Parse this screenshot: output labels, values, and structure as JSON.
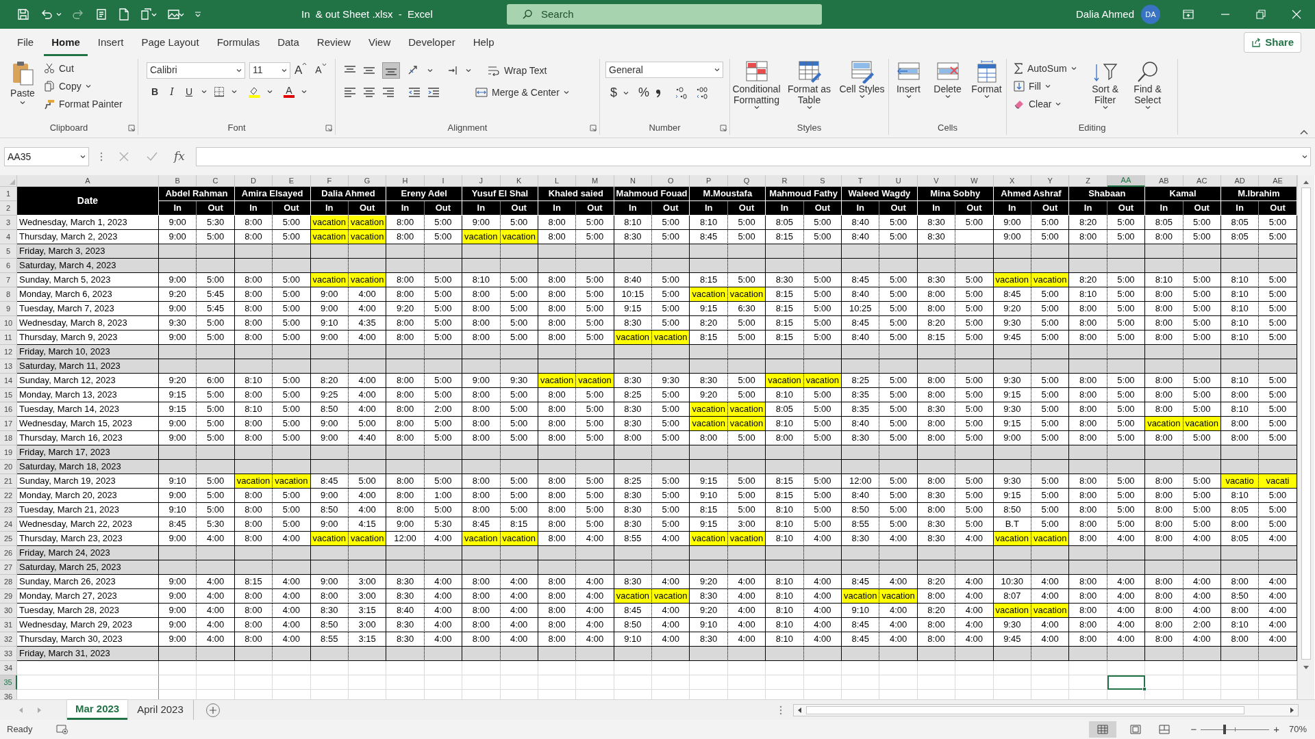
{
  "title_bar": {
    "file_title": "In  & out Sheet .xlsx  -  Excel",
    "search_placeholder": "Search",
    "user_name": "Dalia Ahmed",
    "user_initials": "DA"
  },
  "menu_tabs": [
    {
      "label": "File",
      "selected": false
    },
    {
      "label": "Home",
      "selected": true
    },
    {
      "label": "Insert",
      "selected": false
    },
    {
      "label": "Page Layout",
      "selected": false
    },
    {
      "label": "Formulas",
      "selected": false
    },
    {
      "label": "Data",
      "selected": false
    },
    {
      "label": "Review",
      "selected": false
    },
    {
      "label": "View",
      "selected": false
    },
    {
      "label": "Developer",
      "selected": false
    },
    {
      "label": "Help",
      "selected": false
    }
  ],
  "share": "Share",
  "ribbon": {
    "clipboard": {
      "paste": "Paste",
      "cut": "Cut",
      "copy": "Copy",
      "format_painter": "Format Painter",
      "label": "Clipboard"
    },
    "font": {
      "family": "Calibri",
      "size": "11",
      "grow": "A",
      "shrink": "A",
      "bold": "B",
      "italic": "I",
      "underline": "U",
      "font_color": "A",
      "label": "Font"
    },
    "alignment": {
      "wrap_text": "Wrap Text",
      "merge_center": "Merge & Center",
      "label": "Alignment"
    },
    "number": {
      "format": "General",
      "currency": "$",
      "percent": "%",
      "label": "Number"
    },
    "styles": {
      "buttons": [
        "Conditional Formatting",
        "Format as Table",
        "Cell Styles"
      ],
      "label": "Styles"
    },
    "cells": {
      "buttons": [
        "Insert",
        "Delete",
        "Format"
      ],
      "label": "Cells"
    },
    "editing": {
      "autosum": "AutoSum",
      "fill": "Fill",
      "clear": "Clear",
      "sort_filter": "Sort & Filter",
      "find_select": "Find & Select",
      "label": "Editing"
    }
  },
  "formula_bar": {
    "name_box": "AA35",
    "fx": "fx"
  },
  "sheet": {
    "columns": [
      {
        "letter": "A",
        "selected": false
      },
      {
        "letter": "B",
        "selected": false
      },
      {
        "letter": "C",
        "selected": false
      },
      {
        "letter": "D",
        "selected": false
      },
      {
        "letter": "E",
        "selected": false
      },
      {
        "letter": "F",
        "selected": false
      },
      {
        "letter": "G",
        "selected": false
      },
      {
        "letter": "H",
        "selected": false
      },
      {
        "letter": "I",
        "selected": false
      },
      {
        "letter": "J",
        "selected": false
      },
      {
        "letter": "K",
        "selected": false
      },
      {
        "letter": "L",
        "selected": false
      },
      {
        "letter": "M",
        "selected": false
      },
      {
        "letter": "N",
        "selected": false
      },
      {
        "letter": "O",
        "selected": false
      },
      {
        "letter": "P",
        "selected": false
      },
      {
        "letter": "Q",
        "selected": false
      },
      {
        "letter": "R",
        "selected": false
      },
      {
        "letter": "S",
        "selected": false
      },
      {
        "letter": "T",
        "selected": false
      },
      {
        "letter": "U",
        "selected": false
      },
      {
        "letter": "V",
        "selected": false
      },
      {
        "letter": "W",
        "selected": false
      },
      {
        "letter": "X",
        "selected": false
      },
      {
        "letter": "Y",
        "selected": false
      },
      {
        "letter": "Z",
        "selected": false
      },
      {
        "letter": "AA",
        "selected": true
      },
      {
        "letter": "AB",
        "selected": false
      },
      {
        "letter": "AC",
        "selected": false
      },
      {
        "letter": "AD",
        "selected": false
      },
      {
        "letter": "AE",
        "selected": false
      }
    ],
    "header_row_numbers": [
      "1",
      "2"
    ],
    "date_header": "Date",
    "employees": [
      "Abdel Rahman",
      "Amira Elsayed",
      "Dalia Ahmed",
      "Ereny Adel",
      "Yusuf El Shal",
      "Khaled saied",
      "Mahmoud Fouad",
      "M.Moustafa",
      "Mahmoud Fathy",
      "Waleed Wagdy",
      "Mina Sobhy",
      "Ahmed Ashraf",
      "Shabaan",
      "Kamal",
      "M.Ibrahim"
    ],
    "subheaders": [
      "In",
      "Out",
      "In",
      "Out",
      "In",
      "Out",
      "In",
      "Out",
      "In",
      "Out",
      "In",
      "Out",
      "In",
      "Out",
      "In",
      "Out",
      "In",
      "Out",
      "In",
      "Out",
      "In",
      "Out",
      "In",
      "Out",
      "In",
      "Out",
      "In",
      "Out",
      "In",
      "Out"
    ],
    "rows": [
      {
        "number": "3",
        "date": "Wednesday, March 1, 2023",
        "weekend": false,
        "cells": [
          "9:00",
          "5:30",
          "8:00",
          "5:00",
          {
            "text": "vacation",
            "highlighted": true
          },
          {
            "text": "vacation",
            "highlighted": true
          },
          "8:00",
          "5:00",
          "9:00",
          "5:00",
          "8:00",
          "5:00",
          "8:10",
          "5:00",
          "8:10",
          "5:00",
          "8:05",
          "5:00",
          "8:40",
          "5:00",
          "8:30",
          "5:00",
          "9:00",
          "5:00",
          "8:20",
          "5:00",
          "8:05",
          "5:00",
          "8:05",
          "5:00"
        ]
      },
      {
        "number": "4",
        "date": "Thursday, March 2, 2023",
        "weekend": false,
        "cells": [
          "9:00",
          "5:00",
          "8:00",
          "5:00",
          {
            "text": "vacation",
            "highlighted": true
          },
          {
            "text": "vacation",
            "highlighted": true
          },
          "8:00",
          "5:00",
          {
            "text": "vacation",
            "highlighted": true
          },
          {
            "text": "vacation",
            "highlighted": true
          },
          "8:00",
          "5:00",
          "8:30",
          "5:00",
          "8:45",
          "5:00",
          "8:15",
          "5:00",
          "8:40",
          "5:00",
          "8:30",
          null,
          "9:00",
          "5:00",
          "8:00",
          "5:00",
          "8:00",
          "5:00",
          "8:05",
          "5:00"
        ]
      },
      {
        "number": "5",
        "date": "Friday, March 3, 2023",
        "weekend": true
      },
      {
        "number": "6",
        "date": "Saturday, March 4, 2023",
        "weekend": true
      },
      {
        "number": "7",
        "date": "Sunday, March 5, 2023",
        "weekend": false,
        "cells": [
          "9:00",
          "5:00",
          "8:00",
          "5:00",
          {
            "text": "vacation",
            "highlighted": true
          },
          {
            "text": "vacation",
            "highlighted": true
          },
          "8:00",
          "5:00",
          "8:10",
          "5:00",
          "8:00",
          "5:00",
          "8:40",
          "5:00",
          "8:15",
          "5:00",
          "8:30",
          "5:00",
          "8:45",
          "5:00",
          "8:30",
          "5:00",
          {
            "text": "vacation",
            "highlighted": true
          },
          {
            "text": "vacation",
            "highlighted": true
          },
          "8:20",
          "5:00",
          "8:10",
          "5:00",
          "8:10",
          "5:00"
        ]
      },
      {
        "number": "8",
        "date": "Monday, March 6, 2023",
        "weekend": false,
        "cells": [
          "9:20",
          "5:45",
          "8:00",
          "5:00",
          "9:00",
          "4:00",
          "8:00",
          "5:00",
          "8:00",
          "5:00",
          "8:00",
          "5:00",
          "10:15",
          "5:00",
          {
            "text": "vacation",
            "highlighted": true
          },
          {
            "text": "vacation",
            "highlighted": true
          },
          "8:15",
          "5:00",
          "8:40",
          "5:00",
          "8:00",
          "5:00",
          "8:45",
          "5:00",
          "8:10",
          "5:00",
          "8:00",
          "5:00",
          "8:10",
          "5:00"
        ]
      },
      {
        "number": "9",
        "date": "Tuesday, March 7, 2023",
        "weekend": false,
        "cells": [
          "9:00",
          "5:45",
          "8:00",
          "5:00",
          "9:00",
          "4:00",
          "9:20",
          "5:00",
          "8:00",
          "5:00",
          "8:00",
          "5:00",
          "9:15",
          "5:00",
          "9:15",
          "6:30",
          "8:15",
          "5:00",
          "10:25",
          "5:00",
          "8:00",
          "5:00",
          "9:20",
          "5:00",
          "8:00",
          "5:00",
          "8:00",
          "5:00",
          "8:10",
          "5:00"
        ]
      },
      {
        "number": "10",
        "date": "Wednesday, March 8, 2023",
        "weekend": false,
        "cells": [
          "9:30",
          "5:00",
          "8:00",
          "5:00",
          "9:10",
          "4:35",
          "8:00",
          "5:00",
          "8:00",
          "5:00",
          "8:00",
          "5:00",
          "8:30",
          "5:00",
          "8:20",
          "5:00",
          "8:15",
          "5:00",
          "8:45",
          "5:00",
          "8:20",
          "5:00",
          "9:30",
          "5:00",
          "8:00",
          "5:00",
          "8:00",
          "5:00",
          "8:10",
          "5:00"
        ]
      },
      {
        "number": "11",
        "date": "Thursday, March 9, 2023",
        "weekend": false,
        "cells": [
          "9:00",
          "5:00",
          "8:00",
          "5:00",
          "9:00",
          "4:00",
          "8:00",
          "5:00",
          "8:00",
          "5:00",
          "8:00",
          "5:00",
          {
            "text": "vacation",
            "highlighted": true
          },
          {
            "text": "vacation",
            "highlighted": true
          },
          "8:15",
          "5:00",
          "8:15",
          "5:00",
          "8:40",
          "5:00",
          "8:15",
          "5:00",
          "9:45",
          "5:00",
          "8:00",
          "5:00",
          "8:00",
          "5:00",
          "8:10",
          "5:00"
        ]
      },
      {
        "number": "12",
        "date": "Friday, March 10, 2023",
        "weekend": true
      },
      {
        "number": "13",
        "date": "Saturday, March 11, 2023",
        "weekend": true
      },
      {
        "number": "14",
        "date": "Sunday, March 12, 2023",
        "weekend": false,
        "cells": [
          "9:20",
          "6:00",
          "8:10",
          "5:00",
          "8:20",
          "4:00",
          "8:00",
          "5:00",
          "9:00",
          "9:30",
          {
            "text": "vacation",
            "highlighted": true
          },
          {
            "text": "vacation",
            "highlighted": true
          },
          "8:30",
          "9:30",
          "8:30",
          "5:00",
          {
            "text": "vacation",
            "highlighted": true
          },
          {
            "text": "vacation",
            "highlighted": true
          },
          "8:25",
          "5:00",
          "8:00",
          "5:00",
          "9:30",
          "5:00",
          "8:00",
          "5:00",
          "8:00",
          "5:00",
          "8:10",
          "5:00"
        ]
      },
      {
        "number": "15",
        "date": "Monday, March 13, 2023",
        "weekend": false,
        "cells": [
          "9:15",
          "5:00",
          "8:00",
          "5:00",
          "9:25",
          "4:00",
          "8:00",
          "5:00",
          "8:00",
          "5:00",
          "8:00",
          "5:00",
          "8:25",
          "5:00",
          "9:20",
          "5:00",
          "8:10",
          "5:00",
          "8:35",
          "5:00",
          "8:00",
          "5:00",
          "9:15",
          "5:00",
          "8:00",
          "5:00",
          "8:00",
          "5:00",
          "8:00",
          "5:00"
        ]
      },
      {
        "number": "16",
        "date": "Tuesday, March 14, 2023",
        "weekend": false,
        "cells": [
          "9:15",
          "5:00",
          "8:10",
          "5:00",
          "8:50",
          "4:00",
          "8:00",
          "2:00",
          "8:00",
          "5:00",
          "8:00",
          "5:00",
          "8:30",
          "5:00",
          {
            "text": "vacation",
            "highlighted": true
          },
          {
            "text": "vacation",
            "highlighted": true
          },
          "8:05",
          "5:00",
          "8:35",
          "5:00",
          "8:30",
          "5:00",
          "9:30",
          "5:00",
          "8:00",
          "5:00",
          "8:00",
          "5:00",
          "8:10",
          "5:00"
        ]
      },
      {
        "number": "17",
        "date": "Wednesday, March 15, 2023",
        "weekend": false,
        "cells": [
          "9:00",
          "5:00",
          "8:00",
          "5:00",
          "9:00",
          "5:00",
          "8:00",
          "5:00",
          "8:00",
          "5:00",
          "8:00",
          "5:00",
          "8:30",
          "5:00",
          {
            "text": "vacation",
            "highlighted": true
          },
          {
            "text": "vacation",
            "highlighted": true
          },
          "8:10",
          "5:00",
          "8:40",
          "5:00",
          "8:00",
          "5:00",
          "9:15",
          "5:00",
          "8:00",
          "5:00",
          {
            "text": "vacation",
            "highlighted": true
          },
          {
            "text": "vacation",
            "highlighted": true
          },
          "8:00",
          "5:00"
        ]
      },
      {
        "number": "18",
        "date": "Thursday, March 16, 2023",
        "weekend": false,
        "cells": [
          "9:00",
          "5:00",
          "8:00",
          "5:00",
          "9:00",
          "4:40",
          "8:00",
          "5:00",
          "8:00",
          "5:00",
          "8:00",
          "5:00",
          "8:00",
          "5:00",
          "8:00",
          "5:00",
          "8:00",
          "5:00",
          "8:30",
          "5:00",
          "8:00",
          "5:00",
          "9:00",
          "5:00",
          "8:00",
          "5:00",
          "8:00",
          "5:00",
          "8:00",
          "5:00"
        ]
      },
      {
        "number": "19",
        "date": "Friday, March 17, 2023",
        "weekend": true
      },
      {
        "number": "20",
        "date": "Saturday, March 18, 2023",
        "weekend": true
      },
      {
        "number": "21",
        "date": "Sunday, March 19, 2023",
        "weekend": false,
        "cells": [
          "9:10",
          "5:00",
          {
            "text": "vacation",
            "highlighted": true
          },
          {
            "text": "vacation",
            "highlighted": true
          },
          "8:45",
          "5:00",
          "8:00",
          "5:00",
          "8:00",
          "5:00",
          "8:00",
          "5:00",
          "8:25",
          "5:00",
          "9:15",
          "5:00",
          "8:15",
          "5:00",
          "12:00",
          "5:00",
          "8:00",
          "5:00",
          "9:30",
          "5:00",
          "8:00",
          "5:00",
          "8:00",
          "5:00",
          {
            "text": "vacatio",
            "highlighted": true
          },
          {
            "text": "vacati",
            "highlighted": true
          }
        ]
      },
      {
        "number": "22",
        "date": "Monday, March 20, 2023",
        "weekend": false,
        "cells": [
          "9:00",
          "5:00",
          "8:00",
          "5:00",
          "9:00",
          "4:00",
          "8:00",
          "1:00",
          "8:00",
          "5:00",
          "8:00",
          "5:00",
          "8:30",
          "5:00",
          "9:10",
          "5:00",
          "8:15",
          "5:00",
          "8:40",
          "5:00",
          "8:30",
          "5:00",
          "9:15",
          "5:00",
          "8:00",
          "5:00",
          "8:00",
          "5:00",
          "8:10",
          "5:00"
        ]
      },
      {
        "number": "23",
        "date": "Tuesday, March 21, 2023",
        "weekend": false,
        "cells": [
          "9:10",
          "5:00",
          "8:00",
          "5:00",
          "8:50",
          "4:00",
          "8:00",
          "5:00",
          "8:00",
          "5:00",
          "8:00",
          "5:00",
          "8:30",
          "5:00",
          "8:15",
          "5:00",
          "8:10",
          "5:00",
          "8:50",
          "5:00",
          "8:00",
          "5:00",
          "8:50",
          "5:00",
          "8:00",
          "5:00",
          "8:00",
          "5:00",
          "8:05",
          "5:00"
        ]
      },
      {
        "number": "24",
        "date": "Wednesday, March 22, 2023",
        "weekend": false,
        "cells": [
          "8:45",
          "5:30",
          "8:00",
          "5:00",
          "9:00",
          "4:15",
          "9:00",
          "5:30",
          "8:45",
          "8:15",
          "8:00",
          "5:00",
          "8:30",
          "5:00",
          "9:15",
          "3:00",
          "8:10",
          "5:00",
          "8:55",
          "5:00",
          "8:30",
          "5:00",
          "B.T",
          "5:00",
          "8:00",
          "5:00",
          "8:00",
          "5:00",
          "8:00",
          "5:00"
        ]
      },
      {
        "number": "25",
        "date": "Thursday, March 23, 2023",
        "weekend": false,
        "cells": [
          "9:00",
          "4:00",
          "8:00",
          "4:00",
          {
            "text": "vacation",
            "highlighted": true
          },
          {
            "text": "vacation",
            "highlighted": true
          },
          "12:00",
          "4:00",
          {
            "text": "vacation",
            "highlighted": true
          },
          {
            "text": "vacation",
            "highlighted": true
          },
          "8:00",
          "4:00",
          "8:55",
          "4:00",
          {
            "text": "vacation",
            "highlighted": true
          },
          {
            "text": "vacation",
            "highlighted": true
          },
          "8:10",
          "4:00",
          "8:30",
          "4:00",
          "8:30",
          "4:00",
          {
            "text": "vacation",
            "highlighted": true
          },
          {
            "text": "vacation",
            "highlighted": true
          },
          "8:00",
          "4:00",
          "8:00",
          "4:00",
          "8:05",
          "4:00"
        ]
      },
      {
        "number": "26",
        "date": "Friday, March 24, 2023",
        "weekend": true
      },
      {
        "number": "27",
        "date": "Saturday, March 25, 2023",
        "weekend": true
      },
      {
        "number": "28",
        "date": "Sunday, March 26, 2023",
        "weekend": false,
        "cells": [
          "9:00",
          "4:00",
          "8:15",
          "4:00",
          "9:00",
          "3:00",
          "8:30",
          "4:00",
          "8:00",
          "4:00",
          "8:00",
          "4:00",
          "8:30",
          "4:00",
          "9:20",
          "4:00",
          "8:10",
          "4:00",
          "8:45",
          "4:00",
          "8:20",
          "4:00",
          "10:30",
          "4:00",
          "8:00",
          "4:00",
          "8:00",
          "4:00",
          "8:00",
          "4:00"
        ]
      },
      {
        "number": "29",
        "date": "Monday, March 27, 2023",
        "weekend": false,
        "cells": [
          "9:00",
          "4:00",
          "8:00",
          "4:00",
          "8:00",
          "3:00",
          "8:30",
          "4:00",
          "8:00",
          "4:00",
          "8:00",
          "4:00",
          {
            "text": "vacation",
            "highlighted": true
          },
          {
            "text": "vacation",
            "highlighted": true
          },
          "8:30",
          "4:00",
          "8:10",
          "4:00",
          {
            "text": "vacation",
            "highlighted": true
          },
          {
            "text": "vacation",
            "highlighted": true
          },
          "8:00",
          "4:00",
          "8:07",
          "4:00",
          "8:00",
          "4:00",
          "8:00",
          "4:00",
          "8:50",
          "4:00"
        ]
      },
      {
        "number": "30",
        "date": "Tuesday, March 28, 2023",
        "weekend": false,
        "cells": [
          "9:00",
          "4:00",
          "8:00",
          "4:00",
          "8:30",
          "3:15",
          "8:40",
          "4:00",
          "8:00",
          "4:00",
          "8:00",
          "4:00",
          "8:45",
          "4:00",
          "9:20",
          "4:00",
          "8:10",
          "4:00",
          "9:10",
          "4:00",
          "8:20",
          "4:00",
          {
            "text": "vacation",
            "highlighted": true
          },
          {
            "text": "vacation",
            "highlighted": true
          },
          "8:00",
          "4:00",
          "8:00",
          "4:00",
          "8:00",
          "4:00"
        ]
      },
      {
        "number": "31",
        "date": "Wednesday, March 29, 2023",
        "weekend": false,
        "cells": [
          "9:00",
          "4:00",
          "8:00",
          "4:00",
          "8:50",
          "3:00",
          "8:30",
          "4:00",
          "8:00",
          "4:00",
          "8:00",
          "4:00",
          "8:50",
          "4:00",
          "9:10",
          "4:00",
          "8:10",
          "4:00",
          "8:45",
          "4:00",
          "8:00",
          "4:00",
          "9:30",
          "4:00",
          "8:00",
          "4:00",
          "8:00",
          "2:00",
          "8:10",
          "4:00"
        ]
      },
      {
        "number": "32",
        "date": "Thursday, March 30, 2023",
        "weekend": false,
        "cells": [
          "9:00",
          "4:00",
          "8:00",
          "4:00",
          "8:55",
          "3:15",
          "8:30",
          "4:00",
          "8:00",
          "4:00",
          "8:00",
          "4:00",
          "9:10",
          "4:00",
          "8:30",
          "4:00",
          "8:10",
          "4:00",
          "8:45",
          "4:00",
          "8:00",
          "4:00",
          "9:45",
          "4:00",
          "8:00",
          "4:00",
          "8:00",
          "4:00",
          "8:00",
          "4:00"
        ]
      },
      {
        "number": "33",
        "date": "Friday, March 31, 2023",
        "weekend": true
      }
    ],
    "empty_rows": [
      {
        "number": "34",
        "selected": false
      },
      {
        "number": "35",
        "selected": true
      },
      {
        "number": "36",
        "selected": false
      }
    ]
  },
  "sheet_tabs": [
    {
      "label": "Mar 2023",
      "selected": true
    },
    {
      "label": "April 2023",
      "selected": false
    }
  ],
  "status_bar": {
    "status": "Ready",
    "zoom_out": "−",
    "zoom_in": "+",
    "zoom": "70%",
    "zoom_slider": {
      "level": 0.35
    }
  }
}
